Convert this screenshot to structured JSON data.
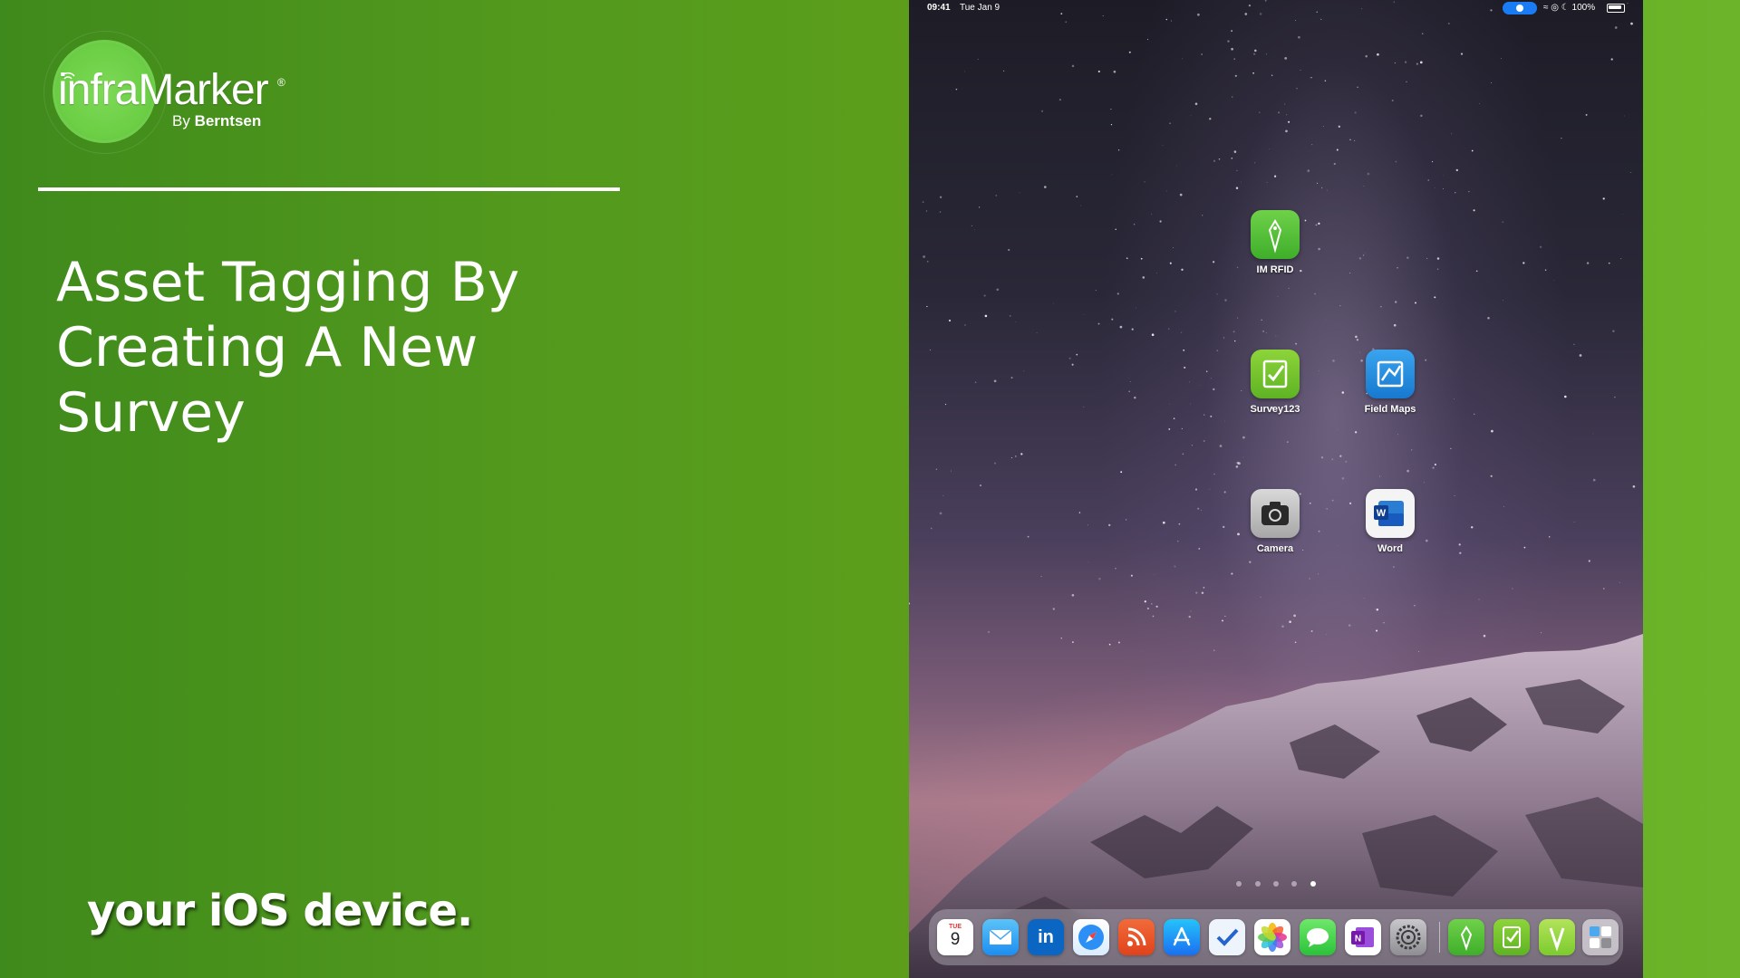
{
  "logo": {
    "brand": "infraMarker",
    "registered": "®",
    "by": "By",
    "company": "Berntsen"
  },
  "title_lines": [
    "Asset Tagging By",
    "Creating A New",
    "Survey"
  ],
  "caption": "your iOS device.",
  "ipad": {
    "status_bar": {
      "time": "09:41",
      "date": "Tue Jan 9",
      "battery": "100%"
    },
    "apps": [
      {
        "label": "IM RFID",
        "icon": "im-rfid-icon"
      },
      {
        "label": "Survey123",
        "icon": "survey123-icon"
      },
      {
        "label": "Field Maps",
        "icon": "field-maps-icon"
      },
      {
        "label": "Camera",
        "icon": "camera-icon"
      },
      {
        "label": "Word",
        "icon": "word-icon"
      }
    ],
    "page_dots": {
      "count": 5,
      "active": 5
    },
    "dock": {
      "calendar_day_name": "TUE",
      "calendar_day": "9",
      "apps": [
        "calendar",
        "mail",
        "linkedin",
        "safari",
        "rss-reader",
        "app-store",
        "tasks",
        "photos",
        "messages",
        "onenote",
        "settings",
        "im-rfid",
        "survey123",
        "inframarker",
        "recent-apps"
      ]
    }
  },
  "colors": {
    "background_green": "#5d9f1c",
    "logo_green": "#6ccf45"
  }
}
